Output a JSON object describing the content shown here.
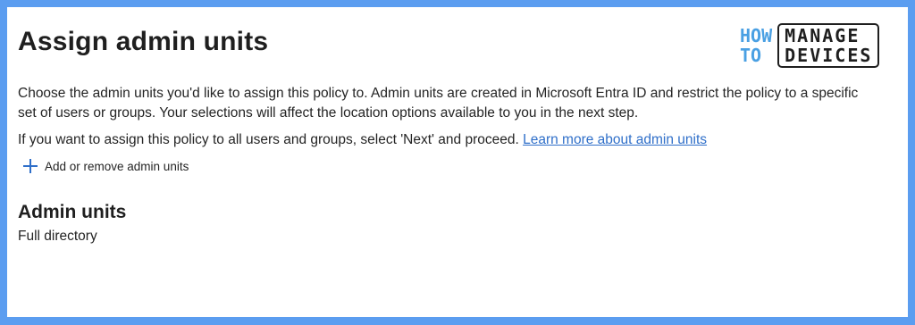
{
  "page": {
    "title": "Assign admin units",
    "description": "Choose the admin units you'd like to assign this policy to. Admin units are created in Microsoft Entra ID and restrict the policy to a specific set of users or groups. Your selections will affect the location options available to you in the next step.",
    "info_text": "If you want to assign this policy to all users and groups, select 'Next' and proceed.",
    "info_link": "Learn more about admin units",
    "add_button_label": "Add or remove admin units",
    "add_button_icon": "plus-icon",
    "section_title": "Admin units",
    "section_value": "Full directory"
  },
  "logo": {
    "word1": "HOW",
    "word2": "TO",
    "word3": "MANAGE",
    "word4": "DEVICES"
  },
  "colors": {
    "frame": "#5b9df0",
    "link": "#2f6fc9",
    "logo_accent": "#4aa0e3"
  }
}
